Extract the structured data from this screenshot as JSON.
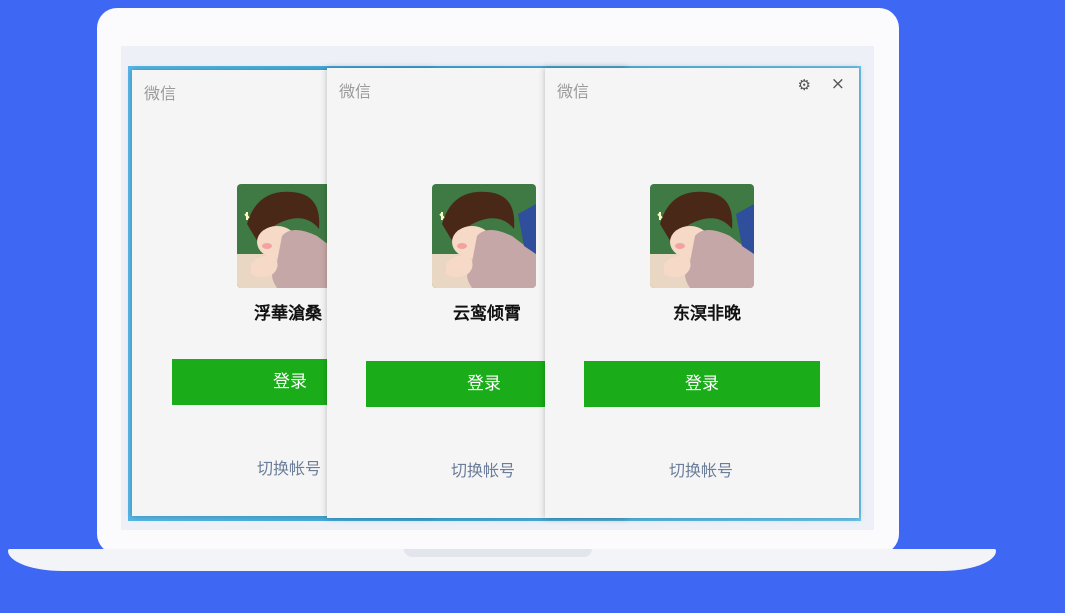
{
  "colors": {
    "background": "#3e67f4",
    "login_button": "#1aad19",
    "switch_link": "#6a7d99",
    "window_bg": "#f5f5f5"
  },
  "windows": [
    {
      "title": "微信",
      "nickname": "浮華滄桑",
      "login_label": "登录",
      "switch_label": "切换帐号",
      "avatar_icon": "cartoon-avatar-icon"
    },
    {
      "title": "微信",
      "nickname": "云鸾倾霄",
      "login_label": "登录",
      "switch_label": "切换帐号",
      "avatar_icon": "cartoon-avatar-icon"
    },
    {
      "title": "微信",
      "nickname": "东溟非晚",
      "login_label": "登录",
      "switch_label": "切换帐号",
      "avatar_icon": "cartoon-avatar-icon",
      "settings_icon": "gear-icon",
      "close_icon": "close-icon"
    }
  ]
}
